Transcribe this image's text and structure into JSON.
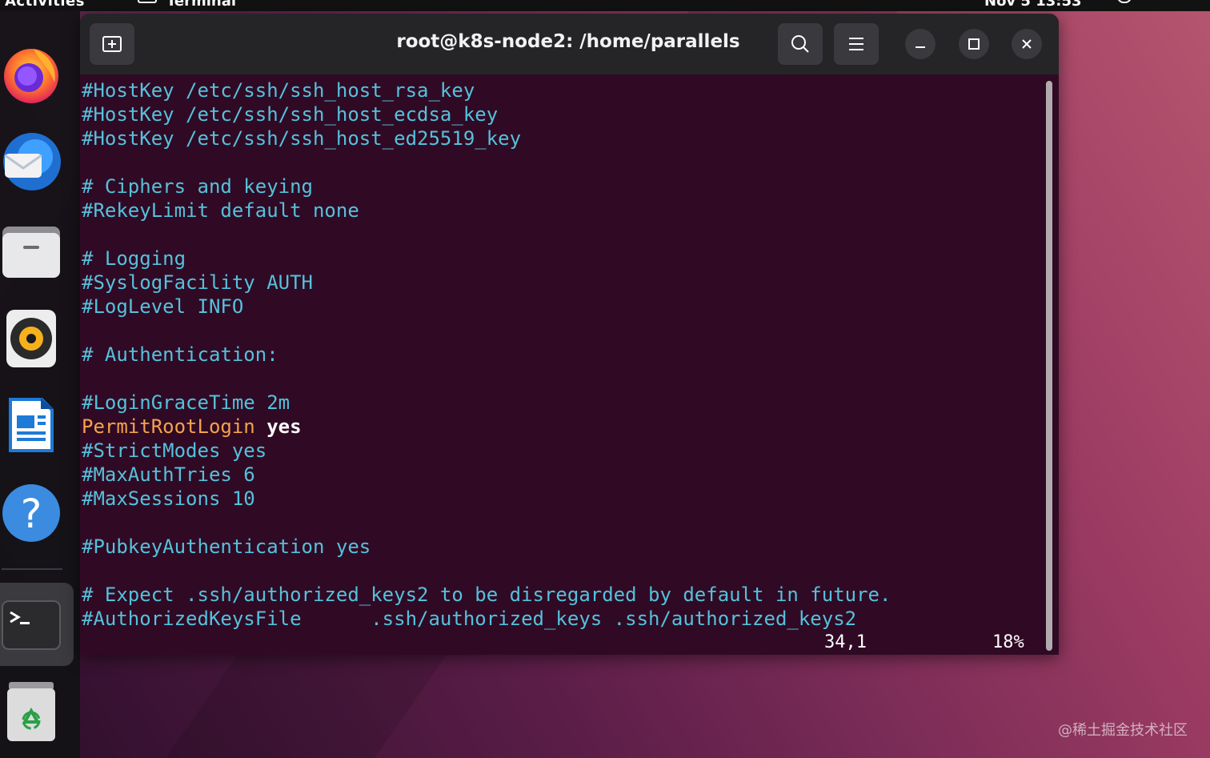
{
  "topbar": {
    "activities": "Activities",
    "app_name": "Terminal",
    "clock": "Nov 5 13:53"
  },
  "dock": {
    "items": [
      "firefox-icon",
      "thunderbird-icon",
      "files-icon",
      "rhythmbox-icon",
      "writer-icon",
      "help-icon",
      "terminal-icon",
      "trash-icon"
    ]
  },
  "window": {
    "title": "root@k8s-node2: /home/parallels"
  },
  "terminal": {
    "lines": [
      "#HostKey /etc/ssh/ssh_host_rsa_key",
      "#HostKey /etc/ssh/ssh_host_ecdsa_key",
      "#HostKey /etc/ssh/ssh_host_ed25519_key",
      "",
      "# Ciphers and keying",
      "#RekeyLimit default none",
      "",
      "# Logging",
      "#SyslogFacility AUTH",
      "#LogLevel INFO",
      "",
      "# Authentication:",
      "",
      "#LoginGraceTime 2m",
      "PermitRootLogin",
      "#StrictModes yes",
      "#MaxAuthTries 6",
      "#MaxSessions 10",
      "",
      "#PubkeyAuthentication yes",
      "",
      "# Expect .ssh/authorized_keys2 to be disregarded by default in future.",
      "#AuthorizedKeysFile      .ssh/authorized_keys .ssh/authorized_keys2"
    ],
    "permit_value": "yes",
    "cursor_position": "34,1",
    "scroll_percent": "18%"
  },
  "watermark": "@稀土掘金技术社区",
  "colors": {
    "terminal_bg": "#300a24",
    "comment_text": "#55c1dc",
    "keyword_text": "#f3a34c",
    "titlebar_bg": "#252528"
  }
}
